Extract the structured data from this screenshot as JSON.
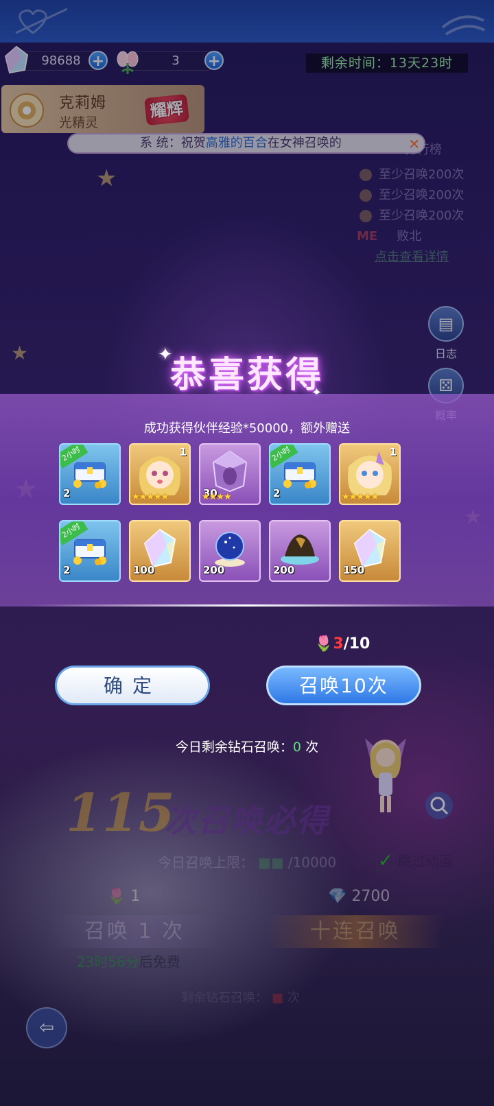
{
  "resources": {
    "diamonds": "98688",
    "tulips": "3",
    "timer": "剩余时间：13天23时"
  },
  "character": {
    "name": "克莉姆",
    "type": "光精灵",
    "badge": "耀辉"
  },
  "broadcast": {
    "prefix": "系  统：祝贺",
    "highlight": "高雅的百合",
    "suffix": "在女神召唤的"
  },
  "ranking": {
    "title": "排行榜",
    "rows": [
      "至少召唤200次",
      "至少召唤200次",
      "至少召唤200次"
    ],
    "me_label": "ME",
    "me_status": "败北",
    "link": "点击查看详情"
  },
  "side_buttons": {
    "log": "日志",
    "rate": "概率"
  },
  "reward": {
    "title": "恭喜获得",
    "description": "成功获得伙伴经验*50000，额外赠送",
    "items": [
      {
        "name": "chest",
        "style": "blue",
        "tag": "2小时",
        "count": "2",
        "icon": "treasure-chest-icon"
      },
      {
        "name": "character-card",
        "style": "gold",
        "level": "1",
        "stars": "★★★★★",
        "icon": "girl-portrait-icon"
      },
      {
        "name": "crystal",
        "style": "purple",
        "count": "30",
        "stars": "★★★★",
        "icon": "purple-crystal-icon"
      },
      {
        "name": "chest",
        "style": "blue",
        "tag": "2小时",
        "count": "2",
        "icon": "treasure-chest-icon"
      },
      {
        "name": "character-card",
        "style": "gold",
        "level": "1",
        "stars": "★★★★★",
        "icon": "elf-portrait-icon"
      },
      {
        "name": "chest",
        "style": "blue",
        "tag": "2小时",
        "count": "2",
        "icon": "treasure-chest-icon"
      },
      {
        "name": "gem",
        "style": "gold",
        "count": "100",
        "icon": "rainbow-gem-icon"
      },
      {
        "name": "orb",
        "style": "purple",
        "count": "200",
        "icon": "star-orb-icon"
      },
      {
        "name": "material",
        "style": "purple",
        "count": "200",
        "icon": "dark-ore-icon"
      },
      {
        "name": "gem",
        "style": "gold",
        "count": "150",
        "icon": "rainbow-gem-icon"
      }
    ]
  },
  "tickets": {
    "current": "3",
    "total": "/10"
  },
  "buttons": {
    "confirm": "确定",
    "summon10": "召唤10次"
  },
  "remaining_today": {
    "prefix": "今日剩余钻石召唤：",
    "value": "0",
    "suffix": "次"
  },
  "background_ui": {
    "guarantee_count": "115",
    "guarantee_text": "次召唤必得",
    "limit_label": "今日召唤上限：",
    "limit_value": "/10000",
    "skip_label": "跳过动画",
    "cost1": "1",
    "cost10": "2700",
    "summon1": "召唤 1 次",
    "summon_ten": "十连召唤",
    "free_time": "23时56分",
    "free_suffix": "后免费",
    "remain_diamond": "剩余钻石召唤：",
    "remain_suffix": "次"
  },
  "colors": {
    "accent_blue": "#2e78e6",
    "highlight_green": "#5de07a",
    "ticket_red": "#ff3b3b"
  }
}
